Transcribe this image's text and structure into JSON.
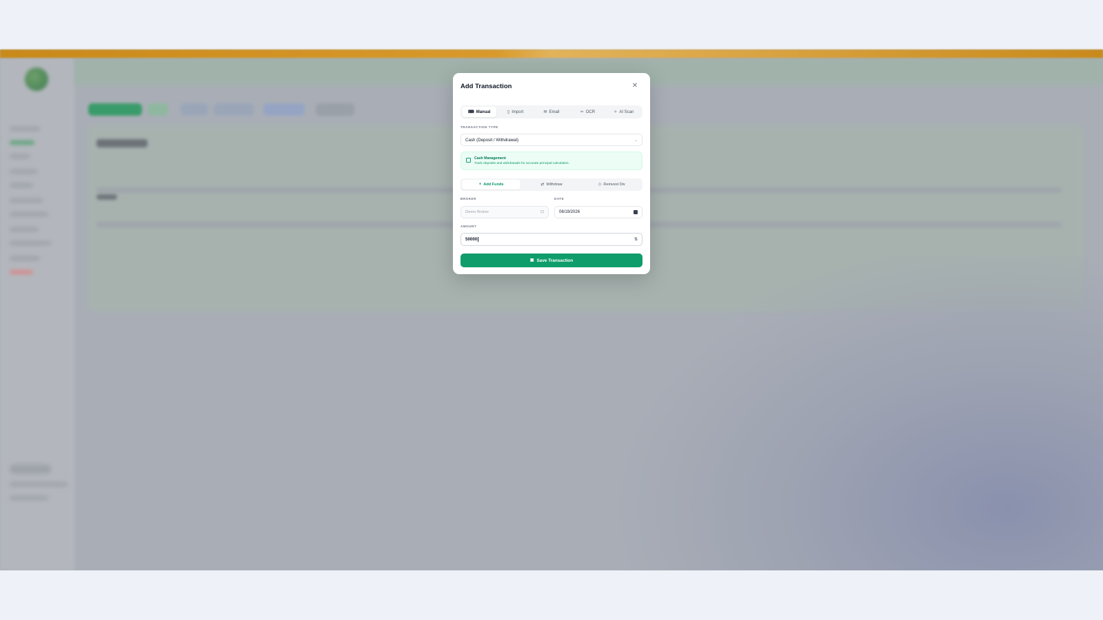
{
  "modal": {
    "title": "Add Transaction",
    "close_icon": "close-icon",
    "tabs": [
      {
        "label": "Manual",
        "icon": "keyboard-icon",
        "active": true
      },
      {
        "label": "Import",
        "icon": "file-icon",
        "active": false
      },
      {
        "label": "Email",
        "icon": "mail-icon",
        "active": false
      },
      {
        "label": "OCR",
        "icon": "scan-icon",
        "active": false
      },
      {
        "label": "AI Scan",
        "icon": "sparkle-icon",
        "active": false
      }
    ],
    "transaction_type": {
      "label": "Transaction Type",
      "value": "Cash (Deposit / Withdrawal)"
    },
    "info": {
      "title": "Cash Management",
      "text": "Track deposits and withdrawals for accurate principal calculation."
    },
    "cash_actions": [
      {
        "label": "Add Funds",
        "icon": "plus-icon",
        "active": true
      },
      {
        "label": "Withdraw",
        "icon": "swap-icon",
        "active": false
      },
      {
        "label": "Reinvest Div",
        "icon": "tag-icon",
        "active": false
      }
    ],
    "broker": {
      "label": "Broker",
      "value": "Demo Broker",
      "icon": "lock-icon"
    },
    "date": {
      "label": "Date",
      "value": "08/19/2026",
      "icon": "calendar-icon"
    },
    "amount": {
      "label": "Amount",
      "value": "50000",
      "icon": "currency-swap-icon"
    },
    "save_label": "Save Transaction",
    "colors": {
      "primary": "#0f9d6b",
      "accent_bar": "#c98a1a"
    }
  }
}
